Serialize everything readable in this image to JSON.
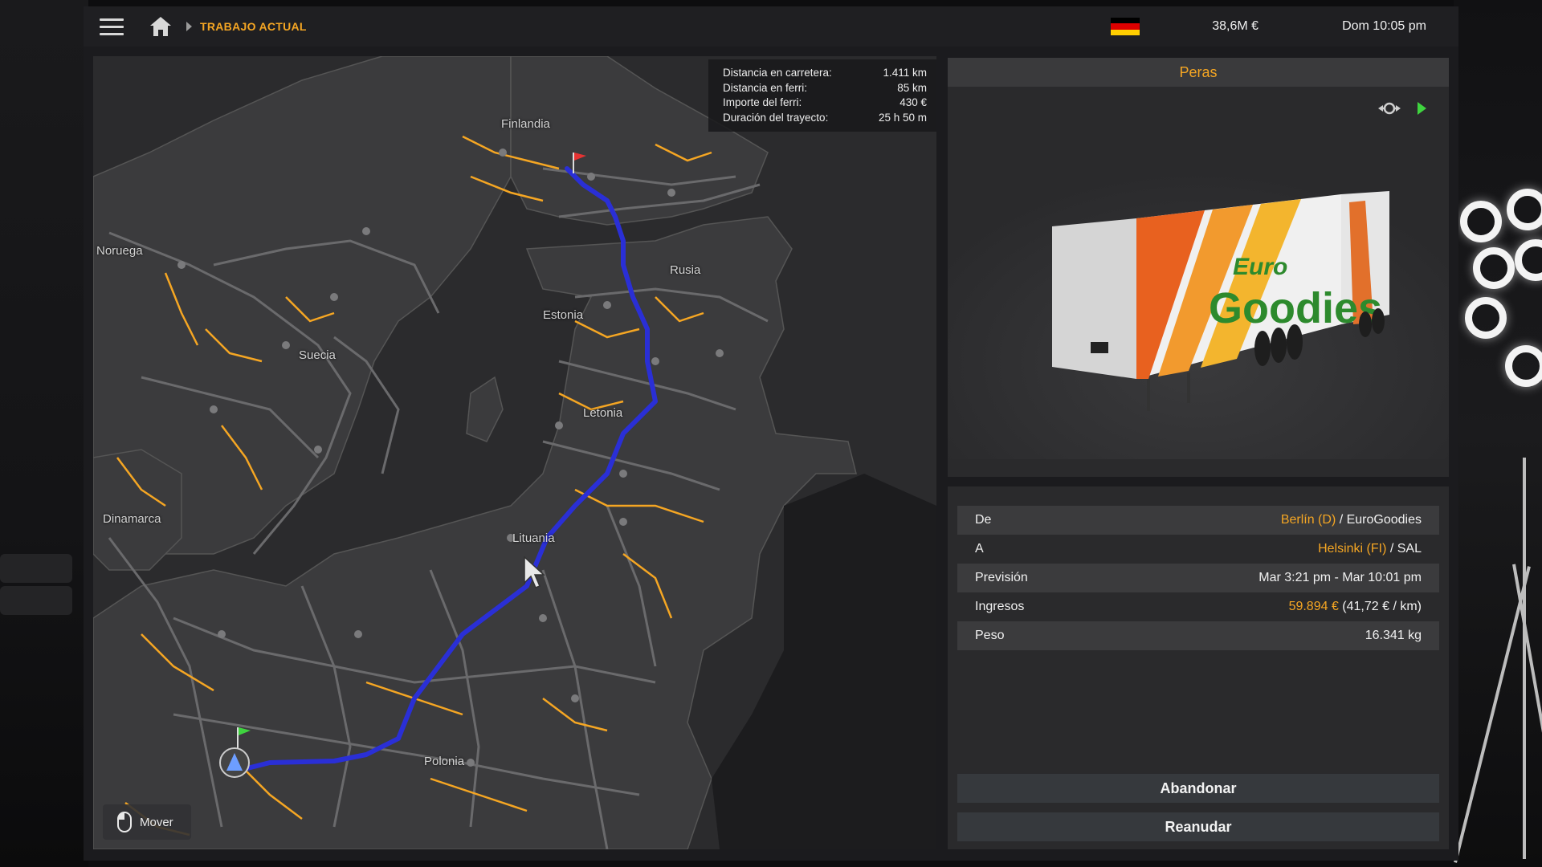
{
  "topbar": {
    "breadcrumb": "TRABAJO ACTUAL",
    "money": "38,6M  €",
    "clock": "Dom 10:05 pm",
    "flag_icon": "germany-flag-icon"
  },
  "map": {
    "labels": {
      "finlandia": "Finlandia",
      "noruega": "Noruega",
      "rusia": "Rusia",
      "estonia": "Estonia",
      "suecia": "Suecia",
      "letonia": "Letonia",
      "dinamarca": "Dinamarca",
      "lituania": "Lituania",
      "polonia": "Polonia"
    },
    "info": [
      {
        "label": "Distancia en carretera:",
        "value": "1.411 km"
      },
      {
        "label": "Distancia en ferri:",
        "value": "85 km"
      },
      {
        "label": "Importe del ferri:",
        "value": "430 €"
      },
      {
        "label": "Duración del trayecto:",
        "value": "25 h 50 m"
      }
    ],
    "mover_label": "Mover",
    "colors": {
      "route": "#2a2fd6",
      "roads": "#f5a623",
      "land": "#3a3a3c",
      "sea": "#262628"
    }
  },
  "cargo": {
    "title": "Peras",
    "brand_line1": "Euro",
    "brand_line2": "Goodies"
  },
  "details": {
    "from": {
      "label": "De",
      "city": "Berlín (D)",
      "company": "EuroGoodies"
    },
    "to": {
      "label": "A",
      "city": "Helsinki (FI)",
      "company": "SAL"
    },
    "forecast": {
      "label": "Previsión",
      "value": "Mar 3:21 pm - Mar 10:01 pm"
    },
    "income": {
      "label": "Ingresos",
      "value": "59.894 €",
      "per_km": "(41,72 € / km)"
    },
    "weight": {
      "label": "Peso",
      "value": "16.341 kg"
    }
  },
  "buttons": {
    "abandon": "Abandonar",
    "resume": "Reanudar"
  }
}
